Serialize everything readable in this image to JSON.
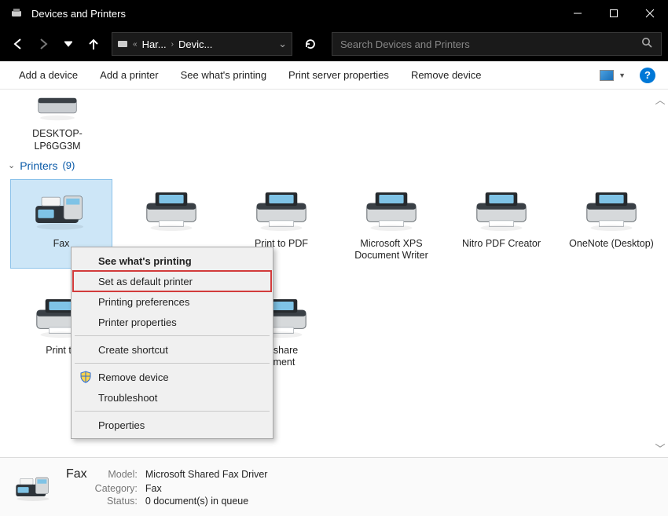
{
  "window": {
    "title": "Devices and Printers"
  },
  "breadcrumb": {
    "root_glyph": "«",
    "crumb1": "Har...",
    "crumb2": "Devic..."
  },
  "search": {
    "placeholder": "Search Devices and Printers"
  },
  "toolbar": {
    "add_device": "Add a device",
    "add_printer": "Add a printer",
    "see_printing": "See what's printing",
    "server_props": "Print server properties",
    "remove_device": "Remove device",
    "help_glyph": "?"
  },
  "device_top": {
    "label": "DESKTOP-LP6GG3M"
  },
  "group": {
    "name": "Printers",
    "count": "(9)"
  },
  "grid_row1": [
    {
      "label": "Fax",
      "type": "fax",
      "selected": true
    },
    {
      "label": "",
      "type": "printer"
    },
    {
      "label": "Print to PDF",
      "type": "printer",
      "clip_left": true
    },
    {
      "label": "Microsoft XPS Document Writer",
      "type": "printer"
    },
    {
      "label": "Nitro PDF Creator",
      "type": "printer"
    },
    {
      "label": "OneNote (Desktop)",
      "type": "printer"
    }
  ],
  "grid_row2": [
    {
      "label": "Print to",
      "type": "printer"
    },
    {
      "label": "",
      "type": "printer"
    },
    {
      "label": "ershare\nement",
      "type": "printer",
      "clip_left": true
    }
  ],
  "context_menu": [
    {
      "label": "See what's printing",
      "bold": true
    },
    {
      "label": "Set as default printer",
      "highlight": true
    },
    {
      "label": "Printing preferences"
    },
    {
      "label": "Printer properties"
    },
    {
      "sep": true
    },
    {
      "label": "Create shortcut"
    },
    {
      "sep": true
    },
    {
      "label": "Remove device",
      "shield": true
    },
    {
      "label": "Troubleshoot"
    },
    {
      "sep": true
    },
    {
      "label": "Properties"
    }
  ],
  "details": {
    "title": "Fax",
    "rows": [
      {
        "k": "Model:",
        "v": "Microsoft Shared Fax Driver"
      },
      {
        "k": "Category:",
        "v": "Fax"
      },
      {
        "k": "Status:",
        "v": "0 document(s) in queue"
      }
    ]
  }
}
